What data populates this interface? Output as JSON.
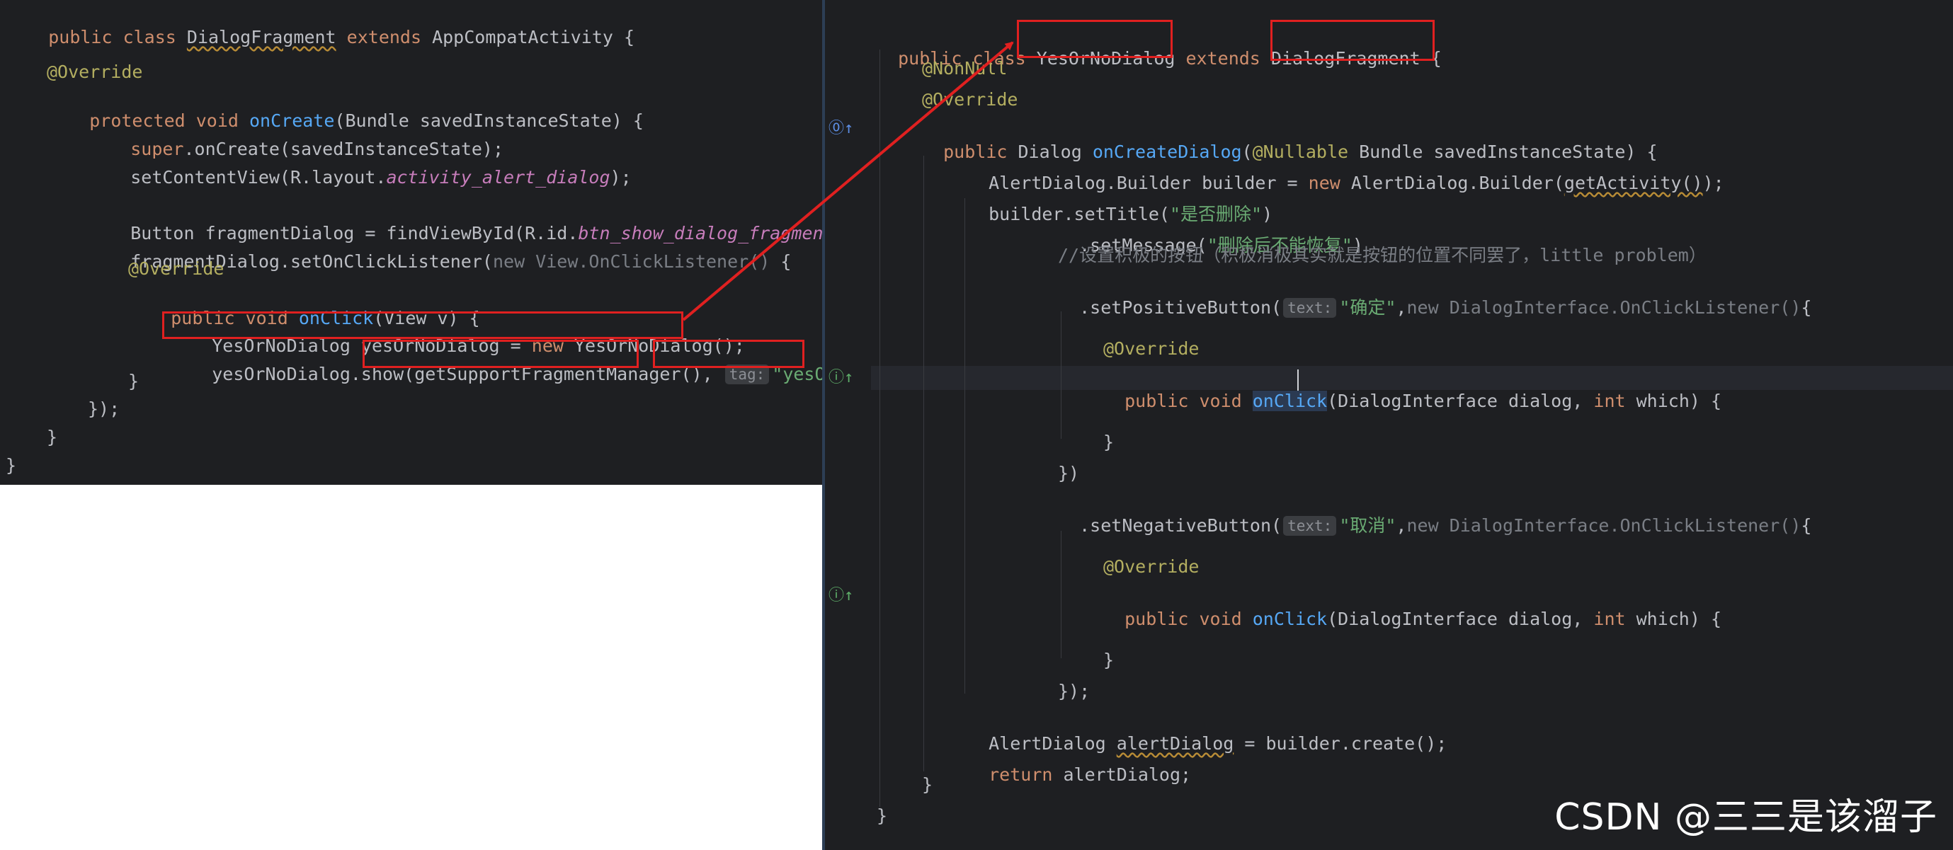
{
  "left_code": {
    "l1": {
      "kw1": "public class ",
      "cls": "DialogFragment",
      "kw2": " extends ",
      "parent": "AppCompatActivity {"
    },
    "l3": "@Override",
    "l4": {
      "kw": "protected void ",
      "fn": "onCreate",
      "rest": "(Bundle savedInstanceState) {"
    },
    "l5": {
      "kw": "super",
      "rest": ".onCreate(savedInstanceState);"
    },
    "l6": {
      "pre": "setContentView(R.layout.",
      "fld": "activity_alert_dialog",
      "post": ");"
    },
    "l8": {
      "pre": "Button fragmentDialog = findViewById(R.id.",
      "fld": "btn_show_dialog_fragment",
      "post": ");"
    },
    "l9": {
      "pre": "fragmentDialog.setOnClickListener(",
      "dim": "new View.OnClickListener()",
      "post": " {"
    },
    "l10": "@Override",
    "l11": {
      "kw": "public void ",
      "fn": "onClick",
      "rest": "(View v) {"
    },
    "l12": {
      "pre": "YesOrNoDialog yesOrNoDialog = ",
      "kw": "new",
      "post": " YesOrNoDialog();"
    },
    "l13": {
      "pre": "yesOrNoDialog.show(",
      "mid": "getSupportFragmentManager()",
      ",": ", ",
      "hint": "tag:",
      "str": "\"yesOrNo\"",
      "post": ");"
    },
    "l14": "}",
    "l15": "});",
    "l16": "}",
    "l17": "}"
  },
  "right_code": {
    "r1": {
      "kw1": "public class ",
      "cls": "YesOrNoDialog",
      "kw2": " extends ",
      "parent": "DialogFragment",
      " {": " {"
    },
    "r2": "@NonNull",
    "r3": "@Override",
    "r4": {
      "kw": "public ",
      "type": "Dialog ",
      "fn": "onCreateDialog",
      "open": "(",
      "ann": "@Nullable",
      "rest": " Bundle savedInstanceState) {"
    },
    "r5": {
      "pre": "AlertDialog.Builder builder = ",
      "kw": "new",
      "mid": " AlertDialog.Builder(",
      "sq": "getActivity()",
      "post": ");"
    },
    "r6": {
      "pre": "builder.setTitle(",
      "str": "\"是否删除\"",
      "post": ")"
    },
    "r7": {
      "pre": ".setMessage(",
      "str": "\"删除后不能恢复\"",
      "post": ")"
    },
    "r8": "//设置积极的按钮（积极消极其实就是按钮的位置不同罢了，little problem）",
    "r9": {
      "pre": ".setPositiveButton(",
      "hint": "text:",
      "str": "\"确定\"",
      ",": ",",
      "dim": "new DialogInterface.OnClickListener()",
      "post": "{"
    },
    "r11": "@Override",
    "r12": {
      "kw": "public void ",
      "fn1": "onCli",
      "fn2": "ck",
      "rest": "(DialogInterface dialog, ",
      "kw2": "int",
      "rest2": " which) {"
    },
    "r14": "}",
    "r15": "})",
    "r16": {
      "pre": ".setNegativeButton(",
      "hint": "text:",
      "str": "\"取消\"",
      ",": ",",
      "dim": "new DialogInterface.OnClickListener()",
      "post": "{"
    },
    "r18": "@Override",
    "r19": {
      "kw": "public void ",
      "fn": "onClick",
      "rest": "(DialogInterface dialog, ",
      "kw2": "int",
      "rest2": " which) {"
    },
    "r21": "}",
    "r22": "});",
    "r23": {
      "pre": "AlertDialog ",
      "sq": "alertDialog",
      "post": " = builder.create();"
    },
    "r24": {
      "kw": "return",
      "post": " alertDialog;"
    },
    "r25": "}",
    "r26": "}"
  },
  "gutter": {
    "override_icon": "⓪↑",
    "implements_icon": "ⓘ↑"
  },
  "watermark": "CSDN @三三是该溜子",
  "colors": {
    "editor_bg": "#1e1f22",
    "keyword": "#cf8e6d",
    "function": "#56a8f5",
    "string": "#6aab73",
    "annotation": "#b3ae60",
    "highlight_box": "#e02020"
  }
}
